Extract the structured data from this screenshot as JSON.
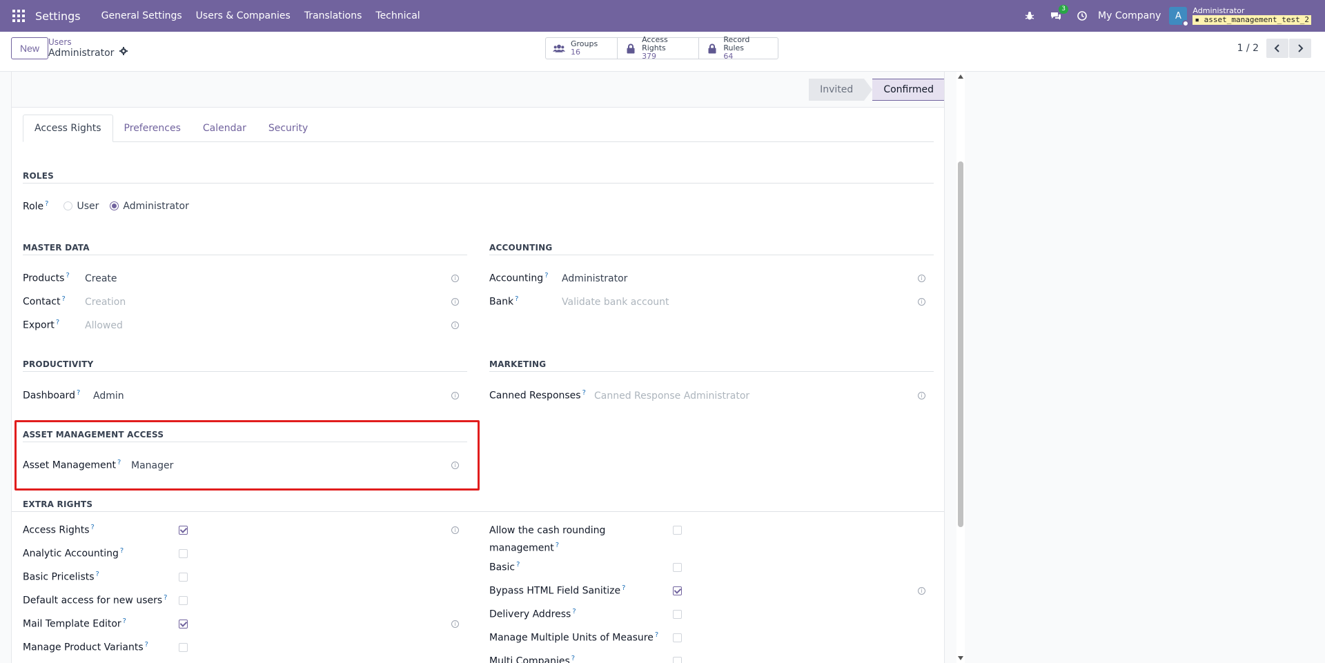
{
  "navbar": {
    "brand": "Settings",
    "menu": [
      "General Settings",
      "Users & Companies",
      "Translations",
      "Technical"
    ],
    "chat_badge": "3",
    "company": "My Company",
    "avatar_letter": "A",
    "user_name": "Administrator",
    "db_name": "asset_management_test_2",
    "accent": "#71639e"
  },
  "control": {
    "new_label": "New",
    "breadcrumb_parent": "Users",
    "breadcrumb_current": "Administrator",
    "stats": [
      {
        "label": "Groups",
        "value": "16",
        "icon": "users-icon"
      },
      {
        "label": "Access Rights",
        "value": "379",
        "icon": "lock-icon"
      },
      {
        "label": "Record Rules",
        "value": "64",
        "icon": "lock-icon"
      }
    ],
    "pager": "1 / 2"
  },
  "status": {
    "stages": [
      "Invited",
      "Confirmed"
    ],
    "active": "Confirmed"
  },
  "tabs": [
    "Access Rights",
    "Preferences",
    "Calendar",
    "Security"
  ],
  "roles": {
    "title": "ROLES",
    "label": "Role",
    "options": [
      "User",
      "Administrator"
    ],
    "selected": "Administrator"
  },
  "master_data": {
    "title": "MASTER DATA",
    "fields": [
      {
        "label": "Products",
        "value": "Create"
      },
      {
        "label": "Contact",
        "value": "Creation"
      },
      {
        "label": "Export",
        "value": "Allowed"
      }
    ]
  },
  "accounting": {
    "title": "ACCOUNTING",
    "fields": [
      {
        "label": "Accounting",
        "value": "Administrator"
      },
      {
        "label": "Bank",
        "value": "Validate bank account"
      }
    ]
  },
  "productivity": {
    "title": "PRODUCTIVITY",
    "fields": [
      {
        "label": "Dashboard",
        "value": "Admin"
      }
    ]
  },
  "marketing": {
    "title": "MARKETING",
    "fields": [
      {
        "label": "Canned Responses",
        "value": "Canned Response Administrator"
      }
    ]
  },
  "asset_management": {
    "title": "ASSET MANAGEMENT ACCESS",
    "fields": [
      {
        "label": "Asset Management",
        "value": "Manager"
      }
    ]
  },
  "extra_rights": {
    "title": "EXTRA RIGHTS",
    "left": [
      {
        "label": "Access Rights",
        "checked": true
      },
      {
        "label": "Analytic Accounting",
        "checked": false
      },
      {
        "label": "Basic Pricelists",
        "checked": false
      },
      {
        "label": "Default access for new users",
        "checked": false
      },
      {
        "label": "Mail Template Editor",
        "checked": true
      },
      {
        "label": "Manage Product Variants",
        "checked": false
      }
    ],
    "right": [
      {
        "label": "Allow the cash rounding management",
        "checked": false
      },
      {
        "label": "Basic",
        "checked": false
      },
      {
        "label": "Bypass HTML Field Sanitize",
        "checked": true
      },
      {
        "label": "Delivery Address",
        "checked": false
      },
      {
        "label": "Manage Multiple Units of Measure",
        "checked": false
      },
      {
        "label": "Multi Companies",
        "checked": false
      }
    ]
  }
}
